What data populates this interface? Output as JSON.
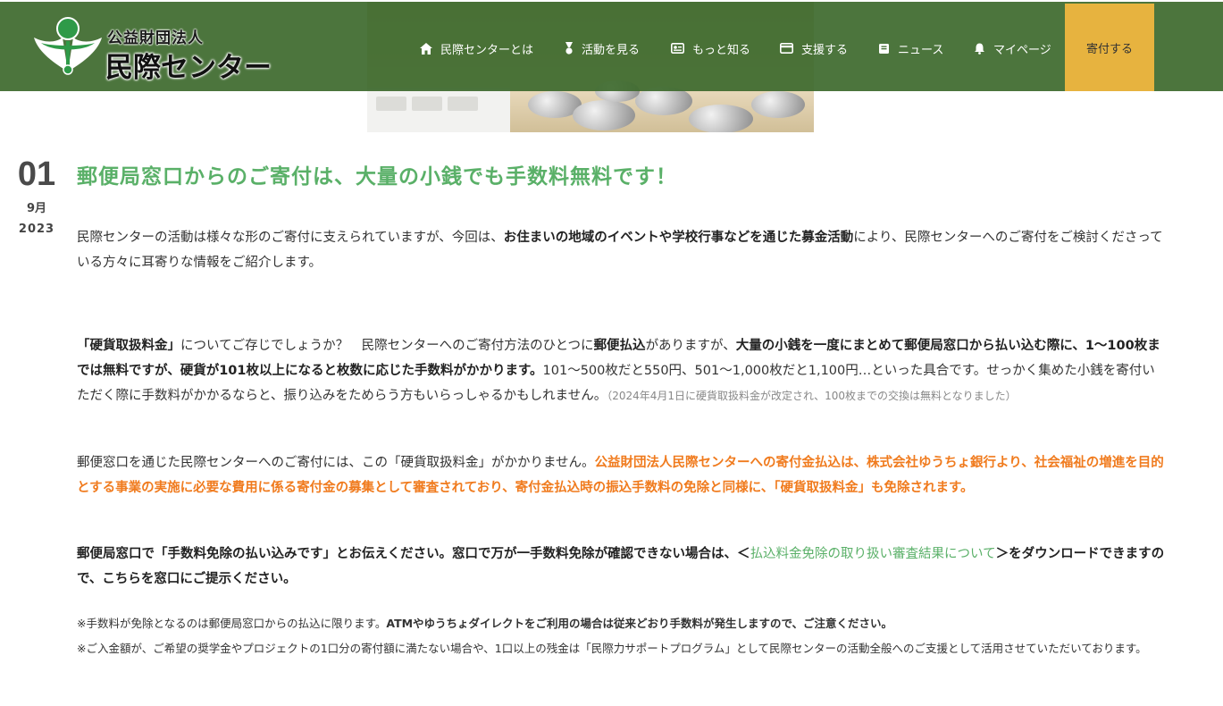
{
  "header": {
    "logo_small": "公益財団法人",
    "logo_big": "民際センター",
    "nav": [
      {
        "label": "民際センターとは",
        "icon": "home-icon"
      },
      {
        "label": "活動を見る",
        "icon": "medal-icon"
      },
      {
        "label": "もっと知る",
        "icon": "id-card-icon"
      },
      {
        "label": "支援する",
        "icon": "credit-card-icon"
      },
      {
        "label": "ニュース",
        "icon": "book-icon"
      },
      {
        "label": "マイページ",
        "icon": "bell-icon"
      }
    ],
    "donate_label": "寄付する",
    "colors": {
      "header_bg": "#3e6a2e",
      "donate_bg": "#e7b33f",
      "title_green": "#5ab068",
      "orange": "#f07b1e"
    }
  },
  "date": {
    "day": "01",
    "month": "9月",
    "year": "2023"
  },
  "article": {
    "title": "郵便局窓口からのご寄付は、大量の小銭でも手数料無料です！",
    "intro": {
      "a": "民際センターの活動は様々な形のご寄付に支えられていますが、今回は、",
      "b": "お住まいの地域のイベントや学校行事などを通じた募金活動",
      "c": "により、民際センターへのご寄付をご検討くださっている方々に耳寄りな情報をご紹介します。"
    },
    "p1": {
      "a": "「硬貨取扱料金」",
      "b": "についてご存じでしょうか？　民際センターへのご寄付方法のひとつに",
      "c": "郵便払込",
      "d": "がありますが、",
      "e": "大量の小銭を一度にまとめて郵便局窓口から払い込む際に、1～100枚までは無料ですが、硬貨が101枚以上になると枚数に応じた手数料がかかります。",
      "f": "101～500枚だと550円、501～1,000枚だと1,100円…といった具合です。せっかく集めた小銭を寄付いただく際に手数料がかかるならと、振り込みをためらう方もいらっしゃるかもしれません。",
      "g": "（2024年4月1日に硬貨取扱料金が改定され、100枚までの交換は無料となりました）"
    },
    "p2": {
      "a": "郵便窓口を通じた民際センターへのご寄付には、この「硬貨取扱料金」がかかりません。",
      "b": "公益財団法人民際センターへの寄付金払込は、株式会社ゆうちょ銀行より、社会福祉の増進を目的とする事業の実施に必要な費用に係る寄付金の募集として審査されており、寄付金払込時の振込手数料の免除と同様に、「硬貨取扱料金」も免除されます。"
    },
    "p3": {
      "a": "郵便局窓口で「手数料免除の払い込みです」とお伝えください。窓口で万が一手数料免除が確認できない場合は、＜",
      "link": "払込料金免除の取り扱い審査結果について",
      "b": "＞をダウンロードできますので、こちらを窓口にご提示ください。"
    },
    "note1": {
      "a": "※手数料が免除となるのは郵便局窓口からの払込に限ります。",
      "b": "ATMやゆうちょダイレクトをご利用の場合は従来どおり手数料が発生しますので、ご注意ください。"
    },
    "note2": "※ご入金額が、ご希望の奨学金やプロジェクトの1口分の寄付額に満たない場合や、1口以上の残金は「民際力サポートプログラム」として民際センターの活動全般へのご支援として活用させていただいております。"
  }
}
